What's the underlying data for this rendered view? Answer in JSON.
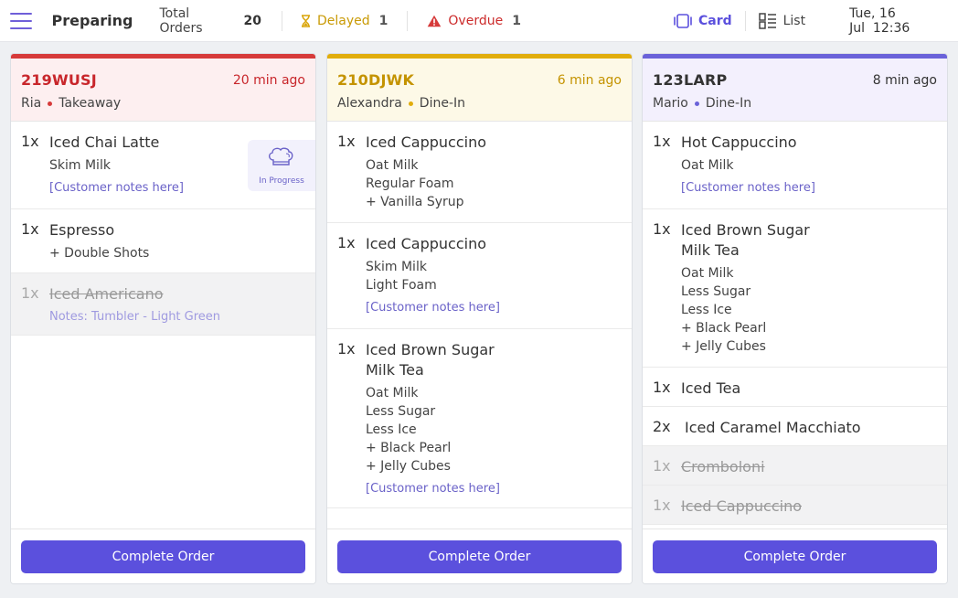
{
  "header": {
    "title": "Preparing",
    "total_label": "Total Orders",
    "total_value": "20",
    "delayed_label": "Delayed",
    "delayed_value": "1",
    "overdue_label": "Overdue",
    "overdue_value": "1",
    "card_label": "Card",
    "list_label": "List",
    "date": "Tue, 16 Jul",
    "time": "12:36"
  },
  "colors": {
    "accent": "#5b50dd",
    "red": "#d63a3a",
    "yellow": "#e1ad0c",
    "purple": "#6a62d9"
  },
  "orders": [
    {
      "id": "219WUSJ",
      "ago": "20 min ago",
      "customer": "Ria",
      "type": "Takeaway",
      "items": [
        {
          "qty": "1x",
          "name": "Iced Chai Latte",
          "mods": [
            "Skim Milk"
          ],
          "note": "[Customer notes here]",
          "badge": "In Progress"
        },
        {
          "qty": "1x",
          "name": "Espresso",
          "mods": [
            "+ Double Shots"
          ]
        },
        {
          "qty": "1x",
          "name": "Iced Americano",
          "note": "Notes: Tumbler - Light Green",
          "done": true
        }
      ],
      "button": "Complete Order"
    },
    {
      "id": "210DJWK",
      "ago": "6 min ago",
      "customer": "Alexandra",
      "type": "Dine-In",
      "items": [
        {
          "qty": "1x",
          "name": "Iced Cappuccino",
          "mods": [
            "Oat Milk",
            "Regular Foam",
            "+ Vanilla Syrup"
          ]
        },
        {
          "qty": "1x",
          "name": "Iced Cappuccino",
          "mods": [
            "Skim Milk",
            "Light Foam"
          ],
          "note": "[Customer notes here]"
        },
        {
          "qty": "1x",
          "name": "Iced Brown Sugar",
          "name2": "Milk Tea",
          "mods": [
            "Oat Milk",
            "Less Sugar",
            "Less Ice",
            "+ Black Pearl",
            "+ Jelly Cubes"
          ],
          "note": "[Customer notes here]"
        }
      ],
      "button": "Complete Order"
    },
    {
      "id": "123LARP",
      "ago": "8 min ago",
      "customer": "Mario",
      "type": "Dine-In",
      "items": [
        {
          "qty": "1x",
          "name": "Hot Cappuccino",
          "mods": [
            "Oat Milk"
          ],
          "note": "[Customer notes here]"
        },
        {
          "qty": "1x",
          "name": "Iced Brown Sugar",
          "name2": "Milk Tea",
          "mods": [
            "Oat Milk",
            "Less Sugar",
            "Less Ice",
            "+ Black Pearl",
            "+ Jelly Cubes"
          ]
        },
        {
          "qty": "1x",
          "name": "Iced Tea"
        },
        {
          "qty": "2x",
          "name": "Iced Caramel Macchiato"
        },
        {
          "qty": "1x",
          "name": "Cromboloni",
          "done": true
        },
        {
          "qty": "1x",
          "name": "Iced Cappuccino",
          "done": true
        }
      ],
      "button": "Complete Order"
    }
  ]
}
